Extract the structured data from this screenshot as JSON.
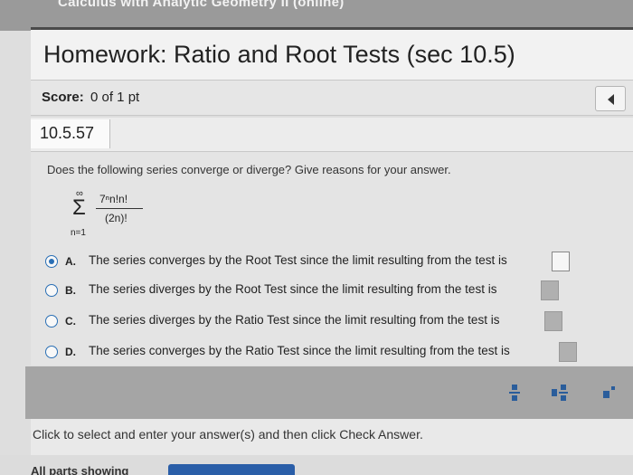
{
  "course": {
    "title": "Calculus with Analytic Geometry II (online)"
  },
  "homework": {
    "title": "Homework: Ratio and Root Tests (sec 10.5)"
  },
  "score": {
    "label": "Score:",
    "value": "0 of 1 pt"
  },
  "question": {
    "number": "10.5.57",
    "prompt": "Does the following series converge or diverge? Give reasons for your answer.",
    "series": {
      "upper": "∞",
      "sigma": "Σ",
      "numerator": "7ⁿn!n!",
      "denominator": "(2n)!",
      "lower": "n=1"
    },
    "options": [
      {
        "letter": "A.",
        "text": "The series converges by the Root Test since the limit resulting from the test is",
        "selected": true
      },
      {
        "letter": "B.",
        "text": "The series diverges by the Root Test since the limit resulting from the test is",
        "selected": false
      },
      {
        "letter": "C.",
        "text": "The series diverges by the Ratio Test since the limit resulting from the test is",
        "selected": false
      },
      {
        "letter": "D.",
        "text": "The series converges by the Ratio Test since the limit resulting from the test is",
        "selected": false
      }
    ]
  },
  "toolbar": {
    "icons": [
      "fraction-icon",
      "mixed-number-icon",
      "exponent-icon"
    ],
    "accent": "#2a5d9b"
  },
  "footer": {
    "instruction": "Click to select and enter your answer(s) and then click Check Answer.",
    "all_parts": "All parts showing"
  },
  "colors": {
    "radio": "#2a6fb5",
    "button": "#2a5ea8"
  }
}
